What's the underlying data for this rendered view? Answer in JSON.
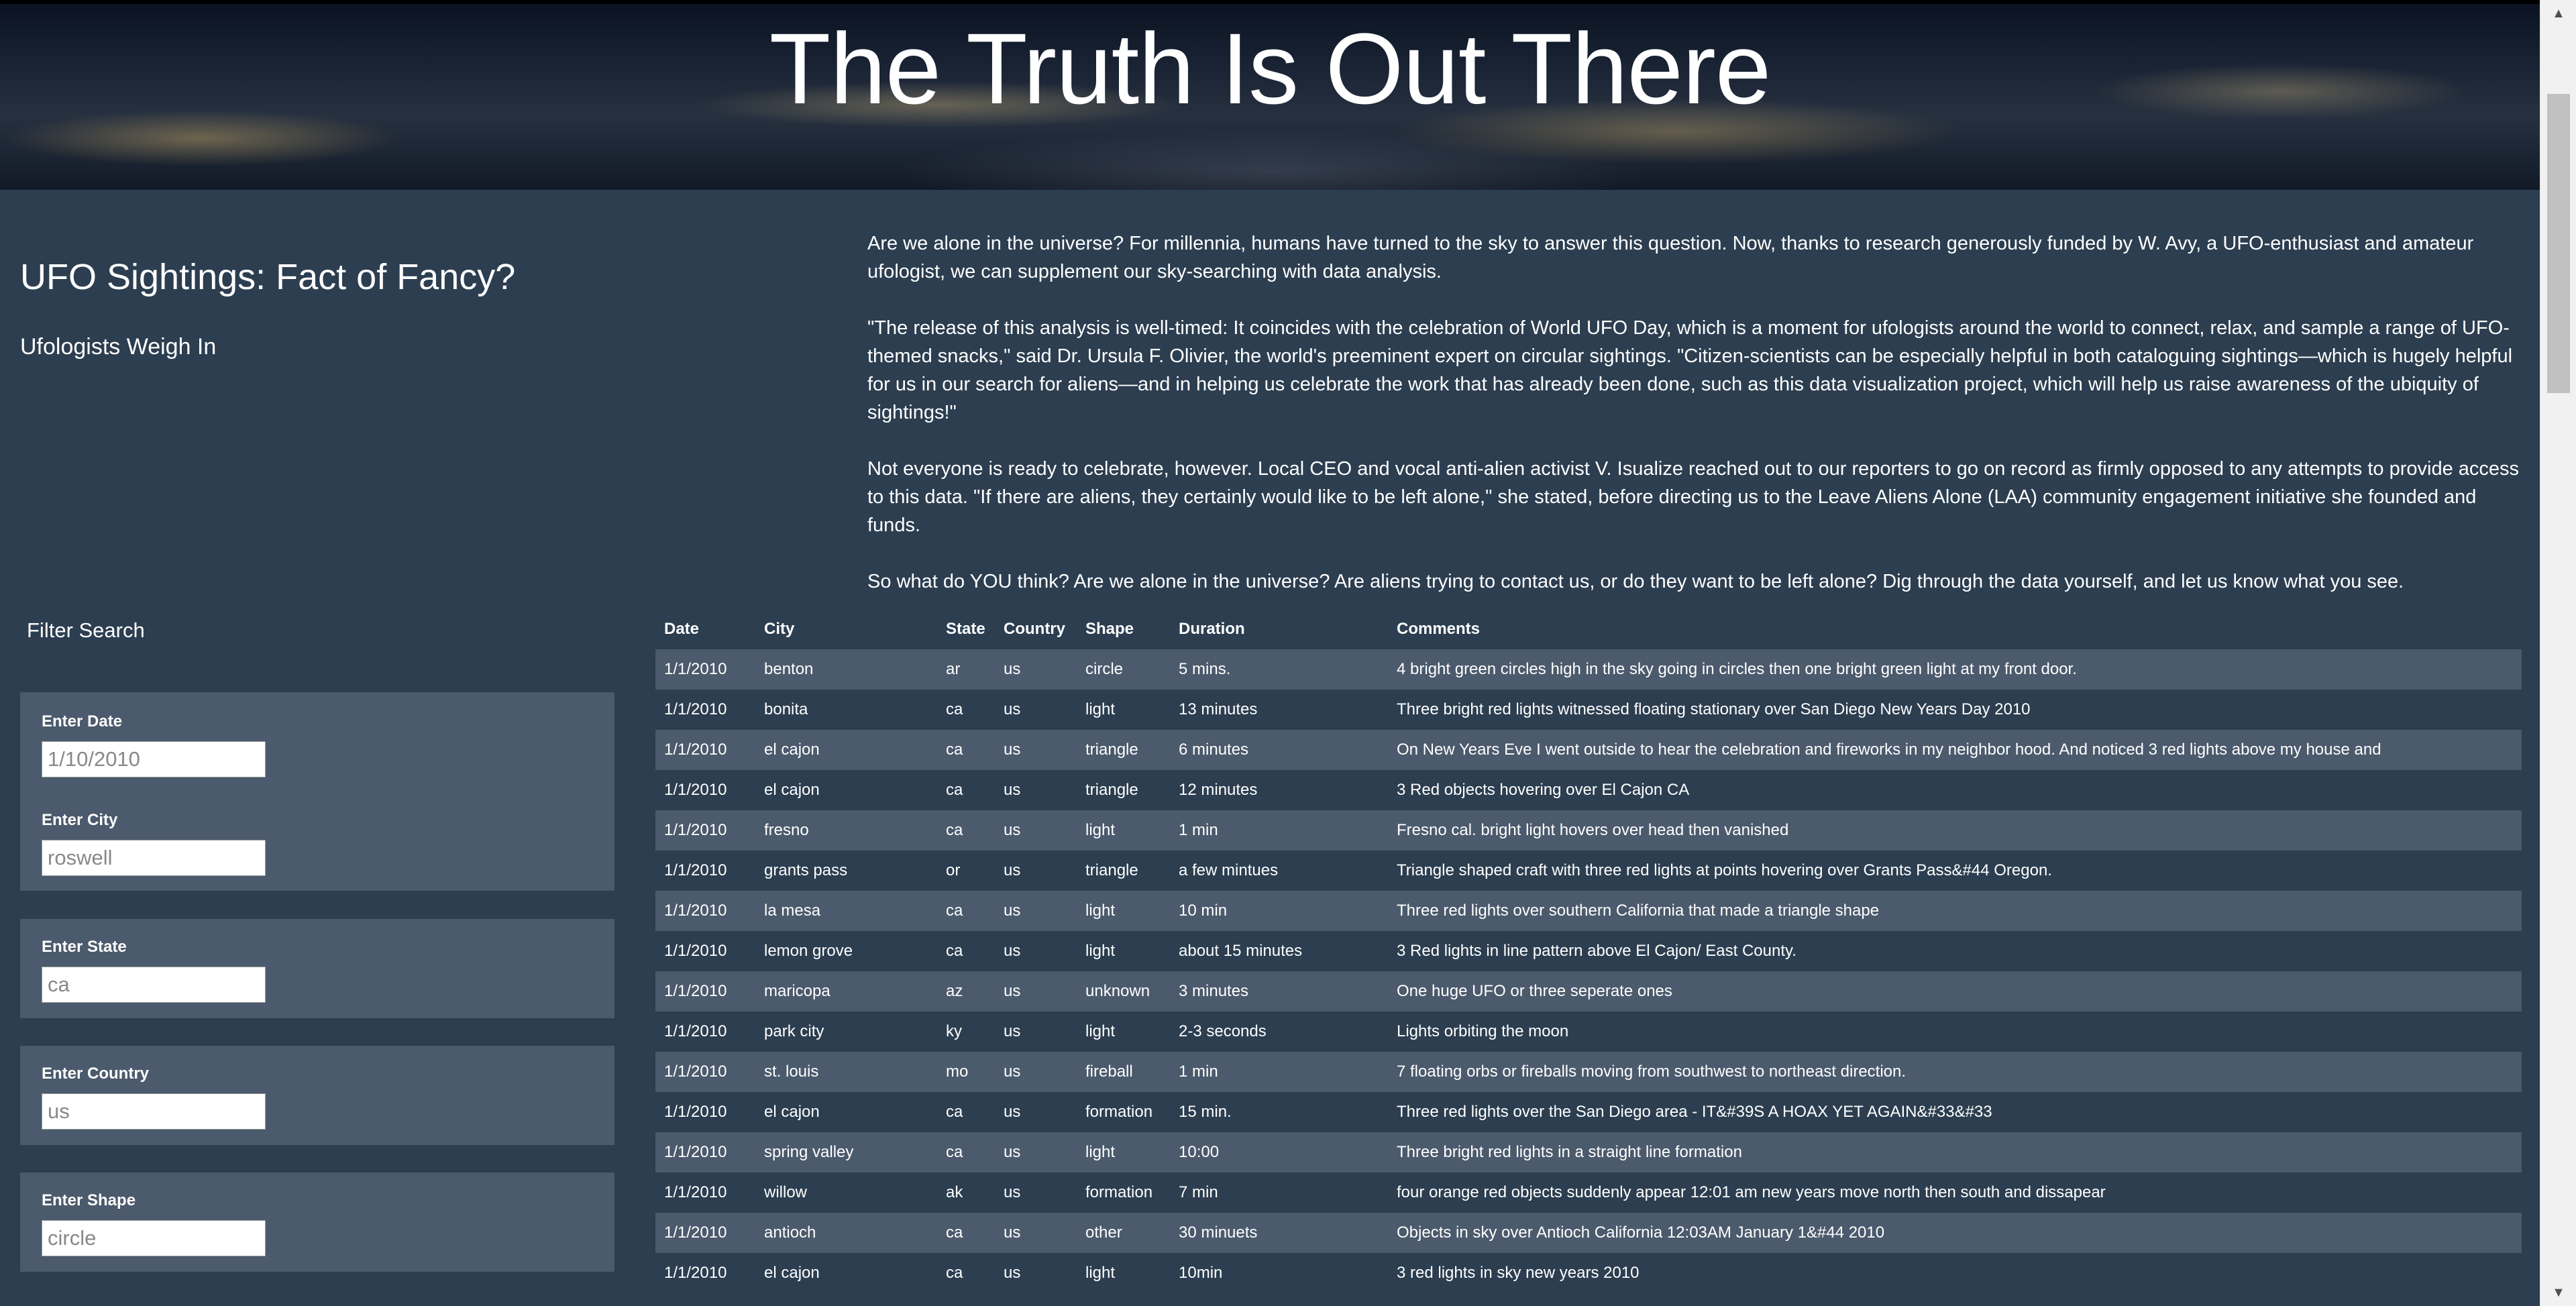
{
  "header": {
    "title": "The Truth Is Out There"
  },
  "intro": {
    "title": "UFO Sightings: Fact of Fancy?",
    "subtitle": "Ufologists Weigh In"
  },
  "article": {
    "paragraphs": [
      "Are we alone in the universe? For millennia, humans have turned to the sky to answer this question. Now, thanks to research generously funded by W. Avy, a UFO-enthusiast and amateur ufologist, we can supplement our sky-searching with data analysis.",
      "\"The release of this analysis is well-timed: It coincides with the celebration of World UFO Day, which is a moment for ufologists around the world to connect, relax, and sample a range of UFO-themed snacks,\" said Dr. Ursula F. Olivier, the world's preeminent expert on circular sightings. \"Citizen-scientists can be especially helpful in both cataloguing sightings—which is hugely helpful for us in our search for aliens—and in helping us celebrate the work that has already been done, such as this data visualization project, which will help us raise awareness of the ubiquity of sightings!\"",
      "Not everyone is ready to celebrate, however. Local CEO and vocal anti-alien activist V. Isualize reached out to our reporters to go on record as firmly opposed to any attempts to provide access to this data. \"If there are aliens, they certainly would like to be left alone,\" she stated, before directing us to the Leave Aliens Alone (LAA) community engagement initiative she founded and funds.",
      "So what do YOU think? Are we alone in the universe? Are aliens trying to contact us, or do they want to be left alone? Dig through the data yourself, and let us know what you see."
    ]
  },
  "filters": {
    "heading": "Filter Search",
    "date": {
      "label": "Enter Date",
      "placeholder": "1/10/2010"
    },
    "city": {
      "label": "Enter City",
      "placeholder": "roswell"
    },
    "state": {
      "label": "Enter State",
      "placeholder": "ca"
    },
    "country": {
      "label": "Enter Country",
      "placeholder": "us"
    },
    "shape": {
      "label": "Enter Shape",
      "placeholder": "circle"
    }
  },
  "table": {
    "headers": [
      "Date",
      "City",
      "State",
      "Country",
      "Shape",
      "Duration",
      "Comments"
    ],
    "rows": [
      [
        "1/1/2010",
        "benton",
        "ar",
        "us",
        "circle",
        "5 mins.",
        "4 bright green circles high in the sky going in circles then one bright green light at my front door."
      ],
      [
        "1/1/2010",
        "bonita",
        "ca",
        "us",
        "light",
        "13 minutes",
        "Three bright red lights witnessed floating stationary over San Diego New Years Day 2010"
      ],
      [
        "1/1/2010",
        "el cajon",
        "ca",
        "us",
        "triangle",
        "6 minutes",
        "On New Years Eve I went outside to hear the celebration and fireworks in my neighbor hood. And noticed 3 red lights above my house and"
      ],
      [
        "1/1/2010",
        "el cajon",
        "ca",
        "us",
        "triangle",
        "12 minutes",
        "3 Red objects hovering over El Cajon CA"
      ],
      [
        "1/1/2010",
        "fresno",
        "ca",
        "us",
        "light",
        "1 min",
        "Fresno cal. bright light hovers over head then vanished"
      ],
      [
        "1/1/2010",
        "grants pass",
        "or",
        "us",
        "triangle",
        "a few mintues",
        "Triangle shaped craft with three red lights at points hovering over Grants Pass&#44 Oregon."
      ],
      [
        "1/1/2010",
        "la mesa",
        "ca",
        "us",
        "light",
        "10 min",
        "Three red lights over southern California that made a triangle shape"
      ],
      [
        "1/1/2010",
        "lemon grove",
        "ca",
        "us",
        "light",
        "about 15 minutes",
        "3 Red lights in line pattern above El Cajon/ East County."
      ],
      [
        "1/1/2010",
        "maricopa",
        "az",
        "us",
        "unknown",
        "3 minutes",
        "One huge UFO or three seperate ones"
      ],
      [
        "1/1/2010",
        "park city",
        "ky",
        "us",
        "light",
        "2-3 seconds",
        "Lights orbiting the moon"
      ],
      [
        "1/1/2010",
        "st. louis",
        "mo",
        "us",
        "fireball",
        "1 min",
        "7 floating orbs or fireballs moving from southwest to northeast direction."
      ],
      [
        "1/1/2010",
        "el cajon",
        "ca",
        "us",
        "formation",
        "15 min.",
        "Three red lights over the San Diego area - IT&#39S A HOAX YET AGAIN&#33&#33"
      ],
      [
        "1/1/2010",
        "spring valley",
        "ca",
        "us",
        "light",
        "10:00",
        "Three bright red lights in a straight line formation"
      ],
      [
        "1/1/2010",
        "willow",
        "ak",
        "us",
        "formation",
        "7 min",
        "four orange red objects suddenly appear 12:01 am new years move north then south and dissapear"
      ],
      [
        "1/1/2010",
        "antioch",
        "ca",
        "us",
        "other",
        "30 minuets",
        "Objects in sky over Antioch California 12:03AM January 1&#44 2010"
      ],
      [
        "1/1/2010",
        "el cajon",
        "ca",
        "us",
        "light",
        "10min",
        "3 red lights in sky new years 2010"
      ]
    ]
  },
  "colors": {
    "background": "#2c3e50",
    "row_stripe": "#4b5a6c",
    "text": "#ffffff"
  }
}
